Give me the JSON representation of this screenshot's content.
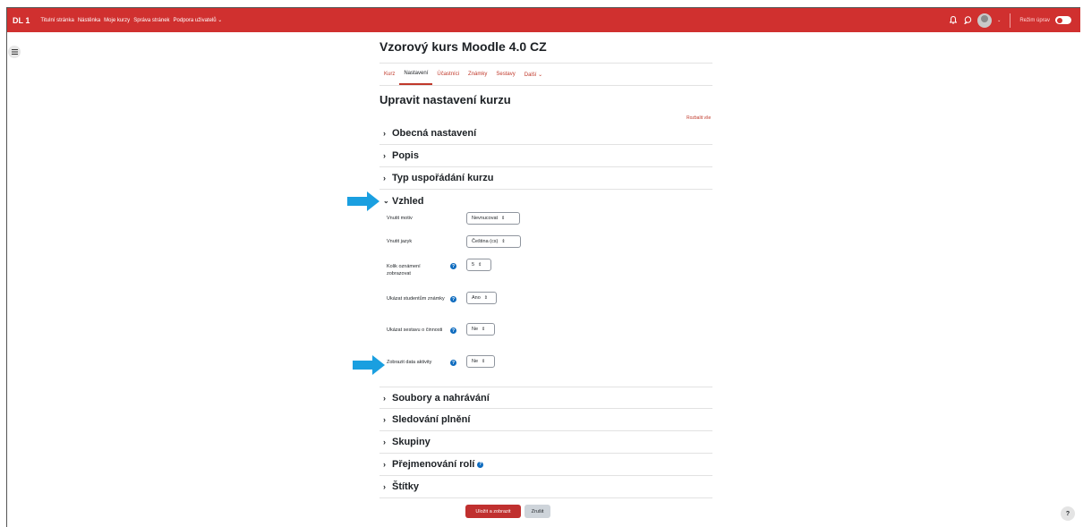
{
  "navbar": {
    "brand": "DL 1",
    "links": [
      "Titulní stránka",
      "Nástěnka",
      "Moje kurzy",
      "Správa stránek",
      "Podpora uživatelů ⌄"
    ],
    "edit_mode_label": "Režim úprav",
    "color": "#d0302f"
  },
  "course": {
    "title": "Vzorový kurs Moodle 4.0 CZ",
    "tabs": [
      "Kurz",
      "Nastavení",
      "Účastníci",
      "Známky",
      "Sestavy",
      "Další ⌄"
    ],
    "active_tab": "Nastavení"
  },
  "form": {
    "heading": "Upravit nastavení kurzu",
    "expand_all": "Rozbalit vše",
    "sections_top": [
      "Obecná nastavení",
      "Popis",
      "Typ uspořádání kurzu"
    ],
    "expanded_section": "Vzhled",
    "fields": [
      {
        "label": "Vnutit motiv",
        "value": "Nevnucovat",
        "help": false
      },
      {
        "label": "Vnutit jazyk",
        "value": "Čeština (cs)",
        "help": false
      },
      {
        "label": "Kolik oznámení zobrazovat",
        "value": "5",
        "help": true
      },
      {
        "label": "Ukázat studentům známky",
        "value": "Ano",
        "help": true
      },
      {
        "label": "Ukázat sestavu o činnosti",
        "value": "Ne",
        "help": true
      },
      {
        "label": "Zobrazit data aktivity",
        "value": "Ne",
        "help": true
      }
    ],
    "sections_bottom": [
      "Soubory a nahrávání",
      "Sledování plnění",
      "Skupiny",
      "Přejmenování rolí",
      "Štítky"
    ],
    "save_label": "Uložit a zobrazit",
    "cancel_label": "Zrušit"
  },
  "accent_color": "#c0302f",
  "annotation_color": "#1a9fe0"
}
